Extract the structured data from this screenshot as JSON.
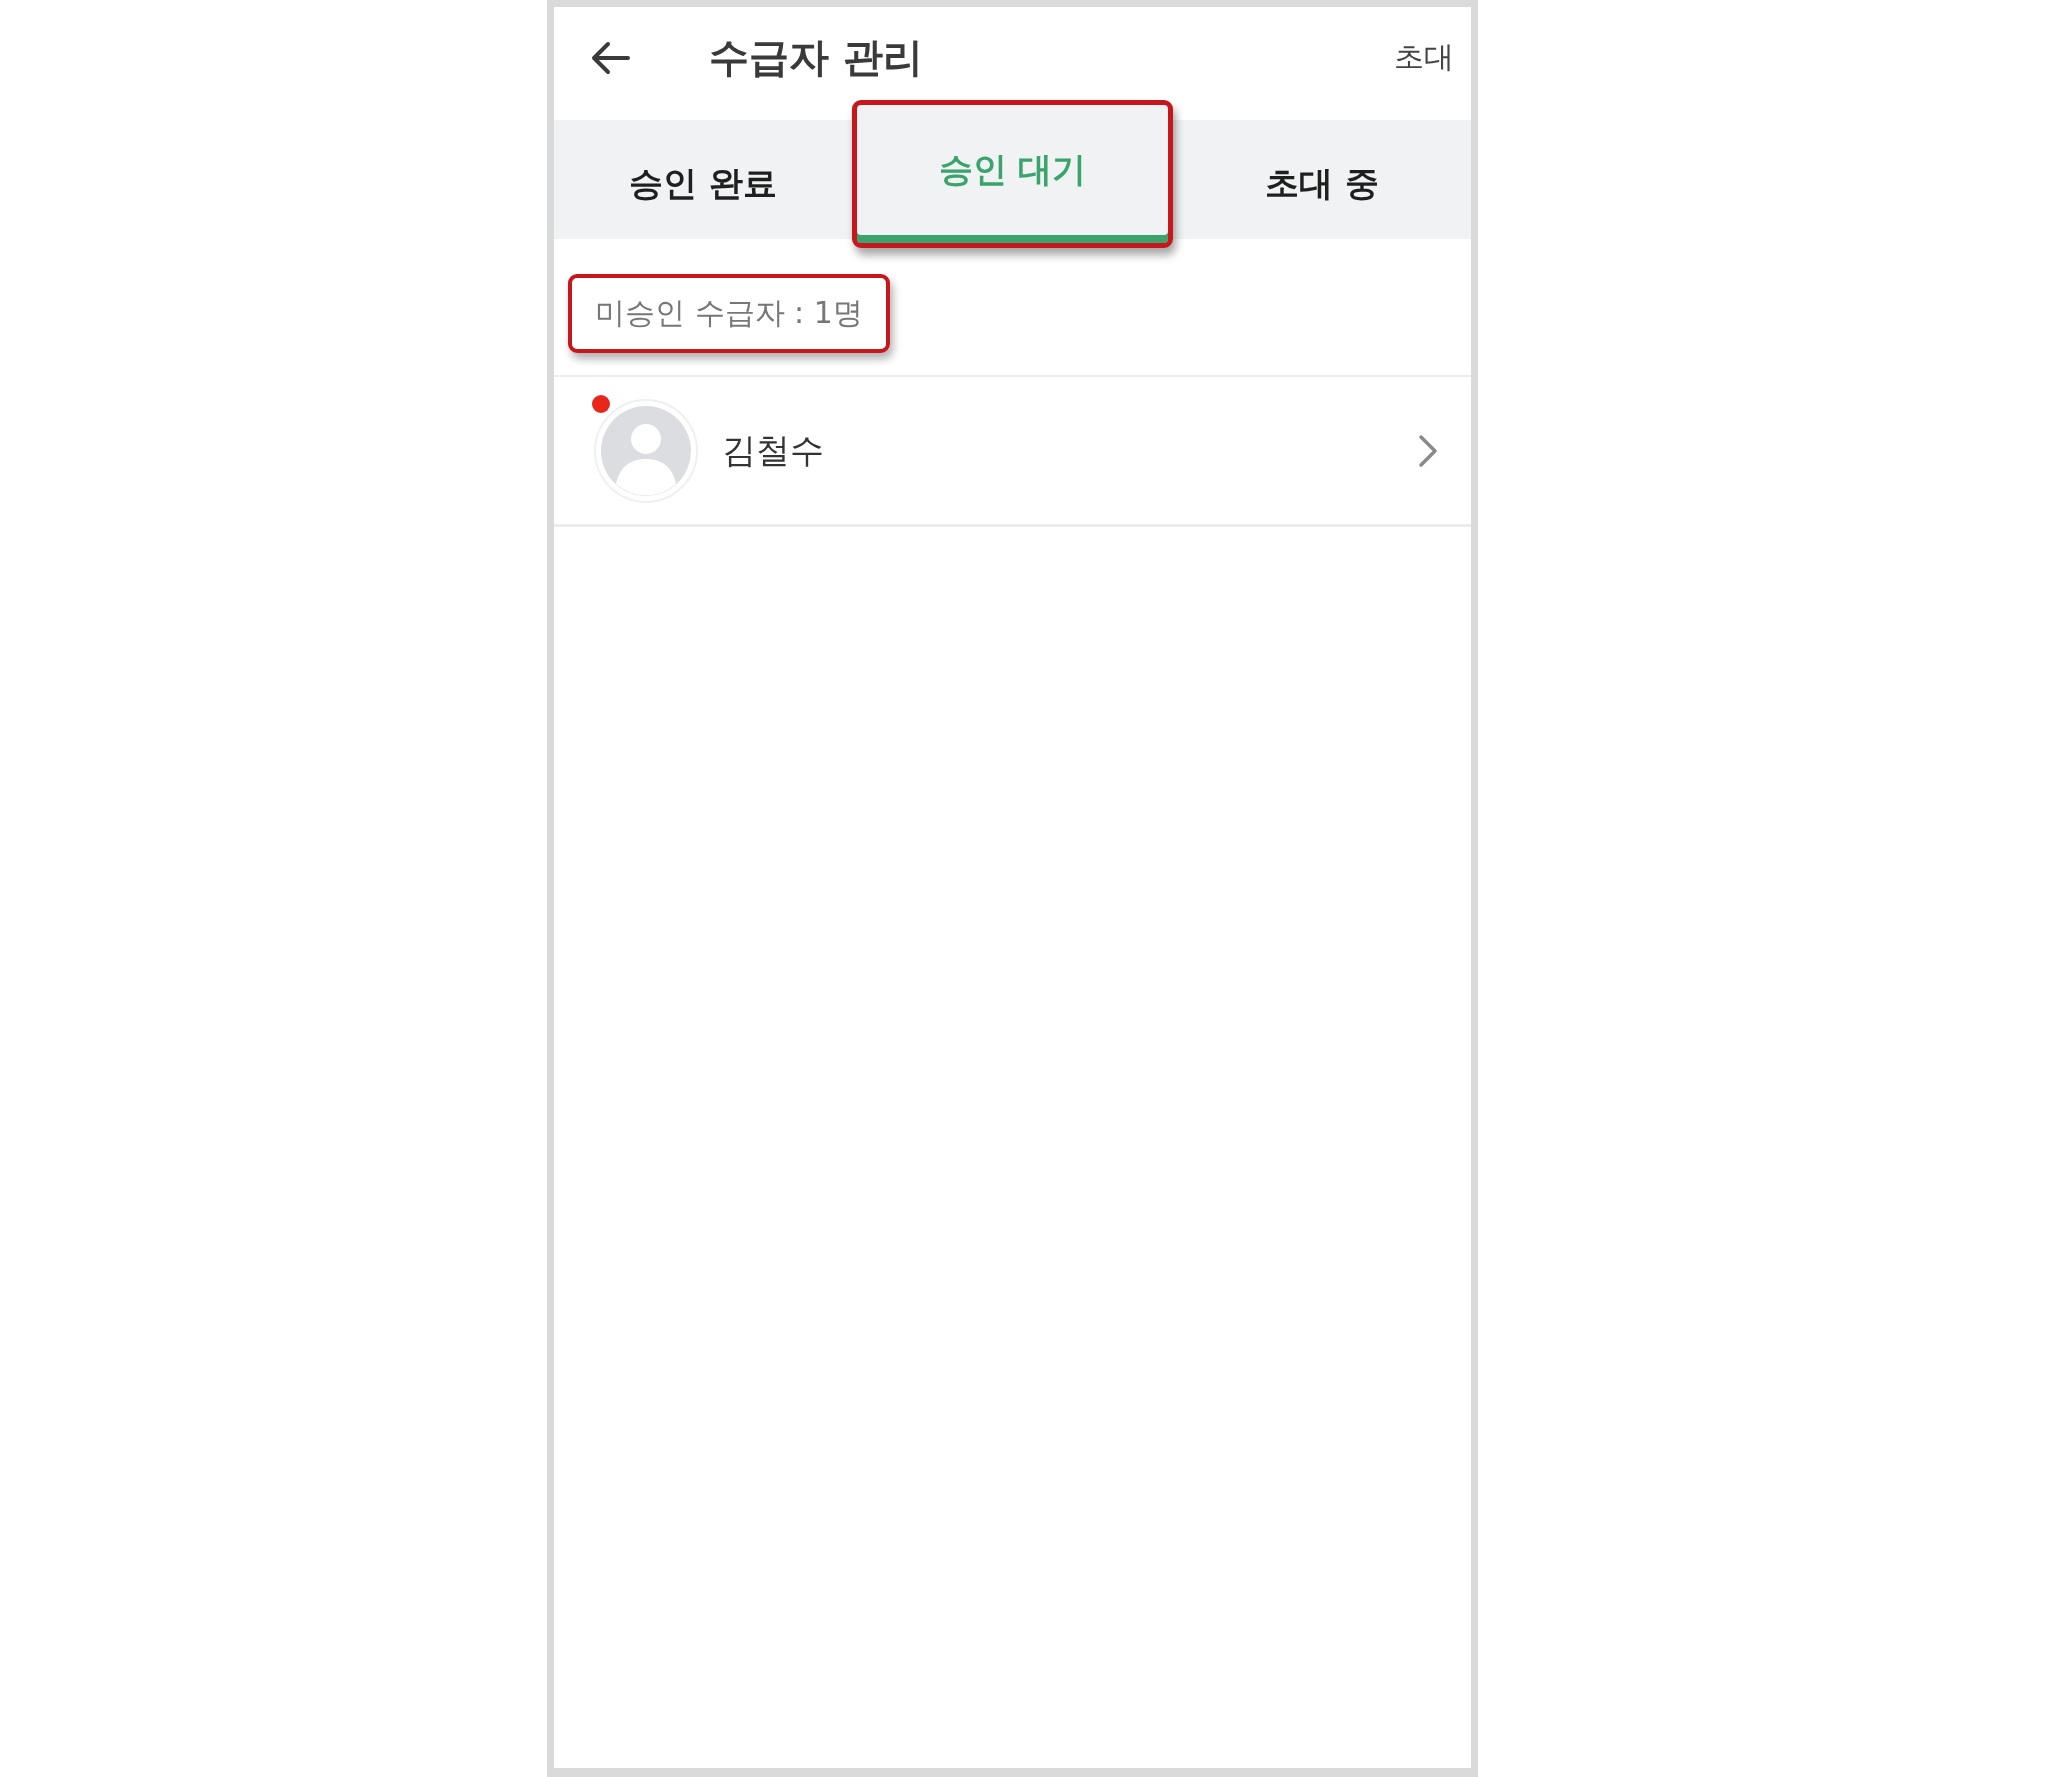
{
  "header": {
    "title": "수급자 관리",
    "action": "초대"
  },
  "tabs": [
    {
      "label": "승인 완료",
      "selected": false,
      "highlighted": false
    },
    {
      "label": "승인 대기",
      "selected": true,
      "highlighted": true
    },
    {
      "label": "초대 중",
      "selected": false,
      "highlighted": false
    }
  ],
  "summary": {
    "text": "미승인 수급자 : 1명",
    "highlighted": true
  },
  "recipients": [
    {
      "name": "김철수",
      "unread": true
    }
  ]
}
